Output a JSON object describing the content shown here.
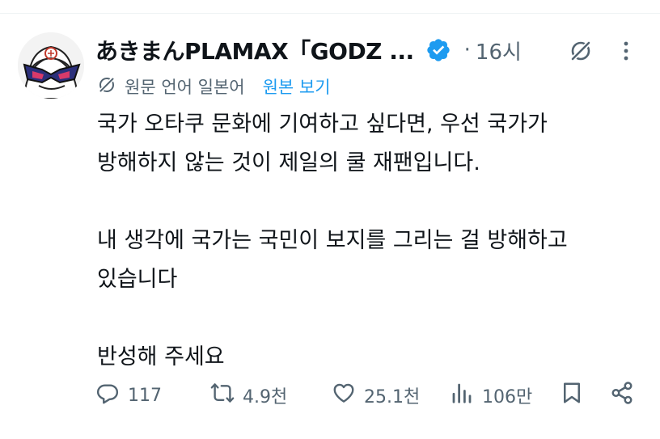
{
  "tweet": {
    "display_name": "あきまんPLAMAX「GODZ ...",
    "separator": "·",
    "time": "16시",
    "translation": {
      "label": "원문 언어 일본어",
      "show_original": "원본 보기"
    },
    "body_lines": [
      "국가 오타쿠 문화에 기여하고 싶다면, 우선 국가가",
      "방해하지 않는 것이 제일의 쿨 재팬입니다.",
      "",
      "내 생각에 국가는 국민이 보지를 그리는 걸 방해하고",
      "있습니다",
      "",
      "반성해 주세요"
    ],
    "actions": {
      "replies": "117",
      "reposts": "4.9천",
      "likes": "25.1천",
      "views": "106만"
    }
  },
  "icons": {
    "verified": "verified-badge-icon",
    "grok": "grok-icon",
    "more": "more-options-icon",
    "translate": "translate-icon",
    "reply": "reply-icon",
    "repost": "repost-icon",
    "like": "heart-icon",
    "views": "analytics-icon",
    "bookmark": "bookmark-icon",
    "share": "share-icon"
  },
  "colors": {
    "text": "#0f1419",
    "secondary": "#536471",
    "accent": "#1d9bf0"
  }
}
